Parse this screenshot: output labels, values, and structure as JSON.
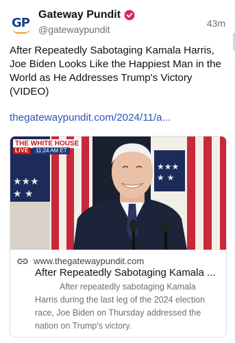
{
  "account": {
    "avatar_text": "GP",
    "name": "Gateway Pundit",
    "handle": "@gatewaypundit",
    "time": "43m",
    "badge_color": "#e0246a"
  },
  "post": {
    "text": "After Repeatedly Sabotaging Kamala Harris, Joe Biden Looks Like the Happiest Man in the World as He Addresses Trump's Victory (VIDEO)",
    "link": "thegatewaypundit.com/2024/11/a..."
  },
  "card": {
    "image_overlay": {
      "source": "THE WHITE HOUSE",
      "live": "LIVE",
      "time": "11:24 AM ET"
    },
    "domain": "www.thegatewaypundit.com",
    "title": "After Repeatedly Sabotaging Kamala ...",
    "description": "After repeatedly sabotaging Kamala Harris during the last leg of the 2024 election race, Joe Biden on Thursday addressed the nation on Trump's victory."
  },
  "colors": {
    "link": "#2a55b8",
    "muted": "#6a6f78",
    "live_red": "#c01818"
  }
}
